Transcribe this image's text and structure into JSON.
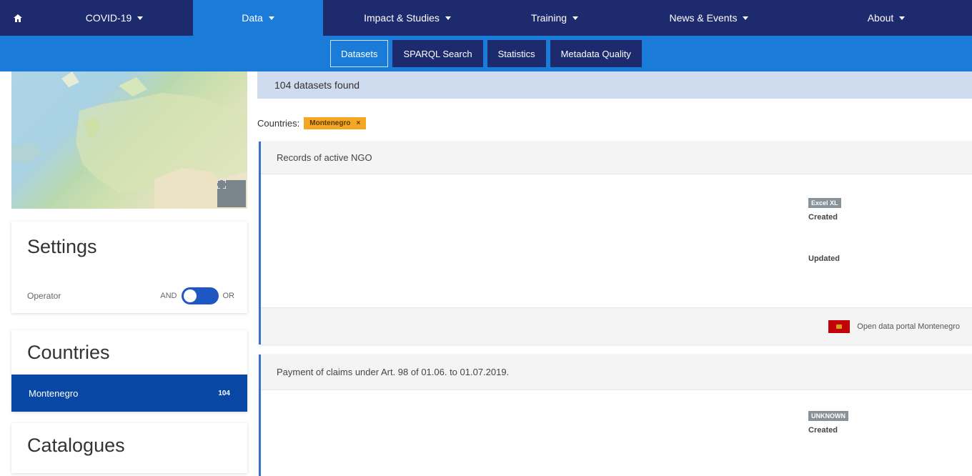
{
  "topnav": {
    "home_icon": "home-icon",
    "items": [
      {
        "label": "COVID-19",
        "active": false
      },
      {
        "label": "Data",
        "active": true
      },
      {
        "label": "Impact & Studies",
        "active": false
      },
      {
        "label": "Training",
        "active": false
      },
      {
        "label": "News & Events",
        "active": false
      },
      {
        "label": "About",
        "active": false
      }
    ]
  },
  "subnav": {
    "items": [
      {
        "label": "Datasets",
        "active": true
      },
      {
        "label": "SPARQL Search",
        "active": false
      },
      {
        "label": "Statistics",
        "active": false
      },
      {
        "label": "Metadata Quality",
        "active": false
      }
    ]
  },
  "map": {
    "fullscreen_icon": "fullscreen-icon"
  },
  "settings": {
    "title": "Settings",
    "operator_label": "Operator",
    "and_label": "AND",
    "or_label": "OR"
  },
  "countries": {
    "title": "Countries",
    "items": [
      {
        "name": "Montenegro",
        "count": "104"
      }
    ]
  },
  "catalogues": {
    "title": "Catalogues"
  },
  "results": {
    "found_text": "104 datasets found"
  },
  "filter": {
    "label": "Countries:",
    "chip": "Montenegro",
    "chip_remove": "×"
  },
  "datasets": [
    {
      "title": "Records of active NGO",
      "format": "Excel XL",
      "created_label": "Created",
      "updated_label": "Updated",
      "catalogue": "Open data portal Montenegro"
    },
    {
      "title": "Payment of claims under Art. 98 of 01.06. to 01.07.2019.",
      "format": "UNKNOWN",
      "created_label": "Created"
    }
  ],
  "colors": {
    "nav_dark": "#1e2a6e",
    "nav_blue": "#1b7bd9",
    "country_selected": "#0847a3",
    "chip": "#f5a623"
  }
}
